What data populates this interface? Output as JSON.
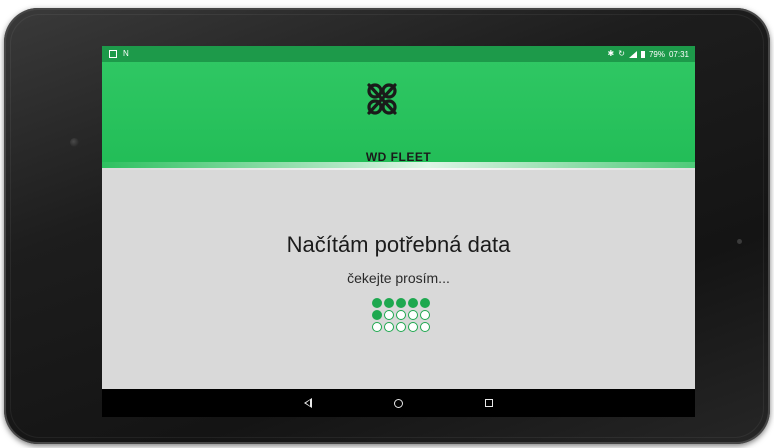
{
  "status_bar": {
    "left_icons": [
      "screenshot-icon",
      "nfc-icon"
    ],
    "right_icons": [
      "bluetooth-icon",
      "sync-icon",
      "signal-icon",
      "battery-icon"
    ],
    "battery_percent": "79%",
    "time": "07:31"
  },
  "header": {
    "brand": "WD FLEET",
    "background": "#27c25c"
  },
  "loading": {
    "title": "Načítám potřebná data",
    "subtitle": "čekejte prosím...",
    "accent": "#1ea84f",
    "dots_rows": [
      [
        true,
        true,
        true,
        true,
        true
      ],
      [
        true,
        false,
        false,
        false,
        false
      ],
      [
        false,
        false,
        false,
        false,
        false
      ]
    ]
  },
  "nav_bar": {
    "buttons": [
      "back-icon",
      "home-icon",
      "recents-icon"
    ]
  }
}
